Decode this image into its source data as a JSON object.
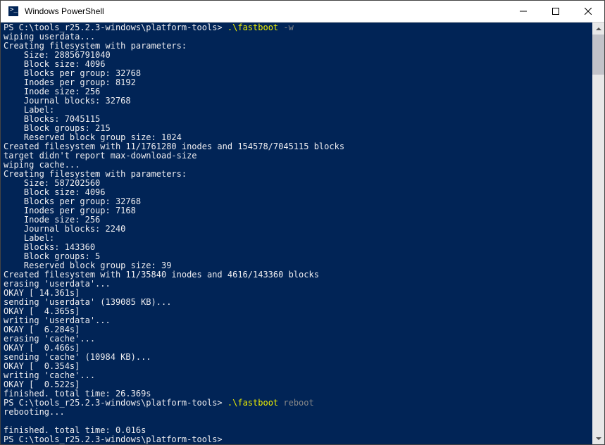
{
  "window": {
    "title": "Windows PowerShell"
  },
  "prompt": {
    "path1": "PS C:\\tools_r25.2.3-windows\\platform-tools> ",
    "cmd1_exe": ".\\fastboot",
    "cmd1_arg": " -w",
    "path2": "PS C:\\tools_r25.2.3-windows\\platform-tools> ",
    "cmd2_exe": ".\\fastboot",
    "cmd2_arg": " reboot",
    "path3": "PS C:\\tools_r25.2.3-windows\\platform-tools>"
  },
  "out": {
    "l01": "wiping userdata...",
    "l02": "Creating filesystem with parameters:",
    "l03": "    Size: 28856791040",
    "l04": "    Block size: 4096",
    "l05": "    Blocks per group: 32768",
    "l06": "    Inodes per group: 8192",
    "l07": "    Inode size: 256",
    "l08": "    Journal blocks: 32768",
    "l09": "    Label:",
    "l10": "    Blocks: 7045115",
    "l11": "    Block groups: 215",
    "l12": "    Reserved block group size: 1024",
    "l13": "Created filesystem with 11/1761280 inodes and 154578/7045115 blocks",
    "l14": "target didn't report max-download-size",
    "l15": "wiping cache...",
    "l16": "Creating filesystem with parameters:",
    "l17": "    Size: 587202560",
    "l18": "    Block size: 4096",
    "l19": "    Blocks per group: 32768",
    "l20": "    Inodes per group: 7168",
    "l21": "    Inode size: 256",
    "l22": "    Journal blocks: 2240",
    "l23": "    Label:",
    "l24": "    Blocks: 143360",
    "l25": "    Block groups: 5",
    "l26": "    Reserved block group size: 39",
    "l27": "Created filesystem with 11/35840 inodes and 4616/143360 blocks",
    "l28": "erasing 'userdata'...",
    "l29": "OKAY [ 14.361s]",
    "l30": "sending 'userdata' (139085 KB)...",
    "l31": "OKAY [  4.365s]",
    "l32": "writing 'userdata'...",
    "l33": "OKAY [  6.284s]",
    "l34": "erasing 'cache'...",
    "l35": "OKAY [  0.466s]",
    "l36": "sending 'cache' (10984 KB)...",
    "l37": "OKAY [  0.354s]",
    "l38": "writing 'cache'...",
    "l39": "OKAY [  0.522s]",
    "l40": "finished. total time: 26.369s",
    "l41": "rebooting...",
    "l42": "",
    "l43": "finished. total time: 0.016s"
  }
}
